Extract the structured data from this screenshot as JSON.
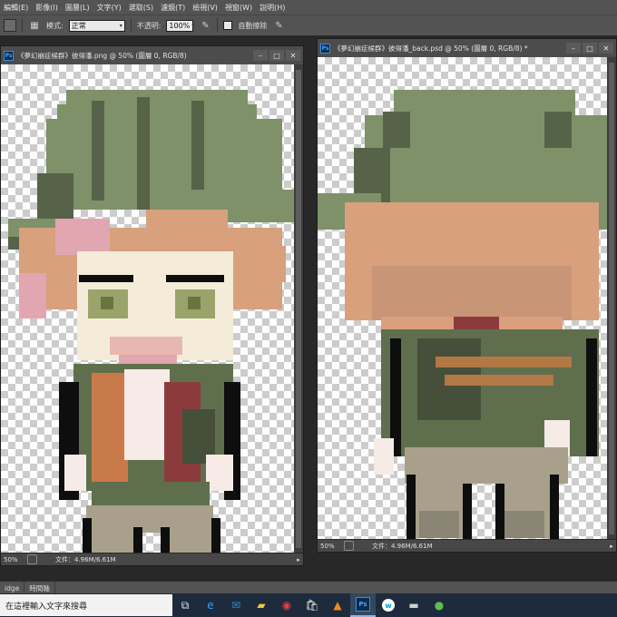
{
  "menu": [
    "編輯(E)",
    "影像(I)",
    "圖層(L)",
    "文字(Y)",
    "選取(S)",
    "濾鏡(T)",
    "檢視(V)",
    "視窗(W)",
    "說明(H)"
  ],
  "options": {
    "mode_label": "模式:",
    "mode_value": "正常",
    "opacity_label": "不透明:",
    "opacity_value": "100%",
    "auto_erase_label": "自動擦除"
  },
  "doc_left": {
    "title": "《夢幻崩症候群》彼得潘.png @ 50% (圖層 0, RGB/8)",
    "zoom": "50%",
    "doc_info": "文件：4.96M/6.61M"
  },
  "doc_right": {
    "title": "《夢幻崩症候群》彼得潘_back.psd @ 50% (圖層 0, RGB/8) *",
    "zoom": "50%",
    "doc_info": "文件：4.96M/6.61M"
  },
  "panel_tabs": [
    "idge",
    "時間軸"
  ],
  "taskbar": {
    "search_placeholder": "在這裡輸入文字來搜尋",
    "icons": [
      "task-view-icon",
      "edge-icon",
      "mail-icon",
      "file-explorer-icon",
      "chrome-icon",
      "store-icon",
      "vlc-icon",
      "photoshop-icon",
      "webex-icon",
      "usb-icon",
      "app-icon"
    ]
  },
  "colors": {
    "hat": "#7e9169",
    "hat_dark": "#576349",
    "hair": "#d8a07c",
    "hair_pink": "#e2a6b0",
    "skin": "#f4ecd8",
    "eyes": "#9aa46a",
    "jacket": "#5f6f4d",
    "jacket_dark": "#464f3a",
    "scarf": "#c97a4a",
    "shirt": "#f6ebe6",
    "vest": "#8c3b3d",
    "pants": "#a9a08c",
    "pants_dark": "#8b8575",
    "outline": "#0e0e0e",
    "strap": "#b27845"
  }
}
